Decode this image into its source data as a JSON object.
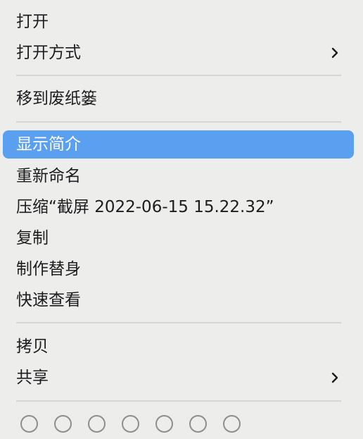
{
  "menu": {
    "items": [
      {
        "label": "打开"
      },
      {
        "label": "打开方式"
      },
      {
        "label": "移到废纸篓"
      },
      {
        "label": "显示简介"
      },
      {
        "label": "重新命名"
      },
      {
        "label": "压缩“截屏 2022-06-15 15.22.32”"
      },
      {
        "label": "复制"
      },
      {
        "label": "制作替身"
      },
      {
        "label": "快速查看"
      },
      {
        "label": "拷贝"
      },
      {
        "label": "共享"
      }
    ],
    "selected_item": "显示简介",
    "tag_colors_count": 7,
    "colors": {
      "highlight": "#5b9ff0",
      "text": "#1d1d1f",
      "background": "#ededec"
    }
  }
}
